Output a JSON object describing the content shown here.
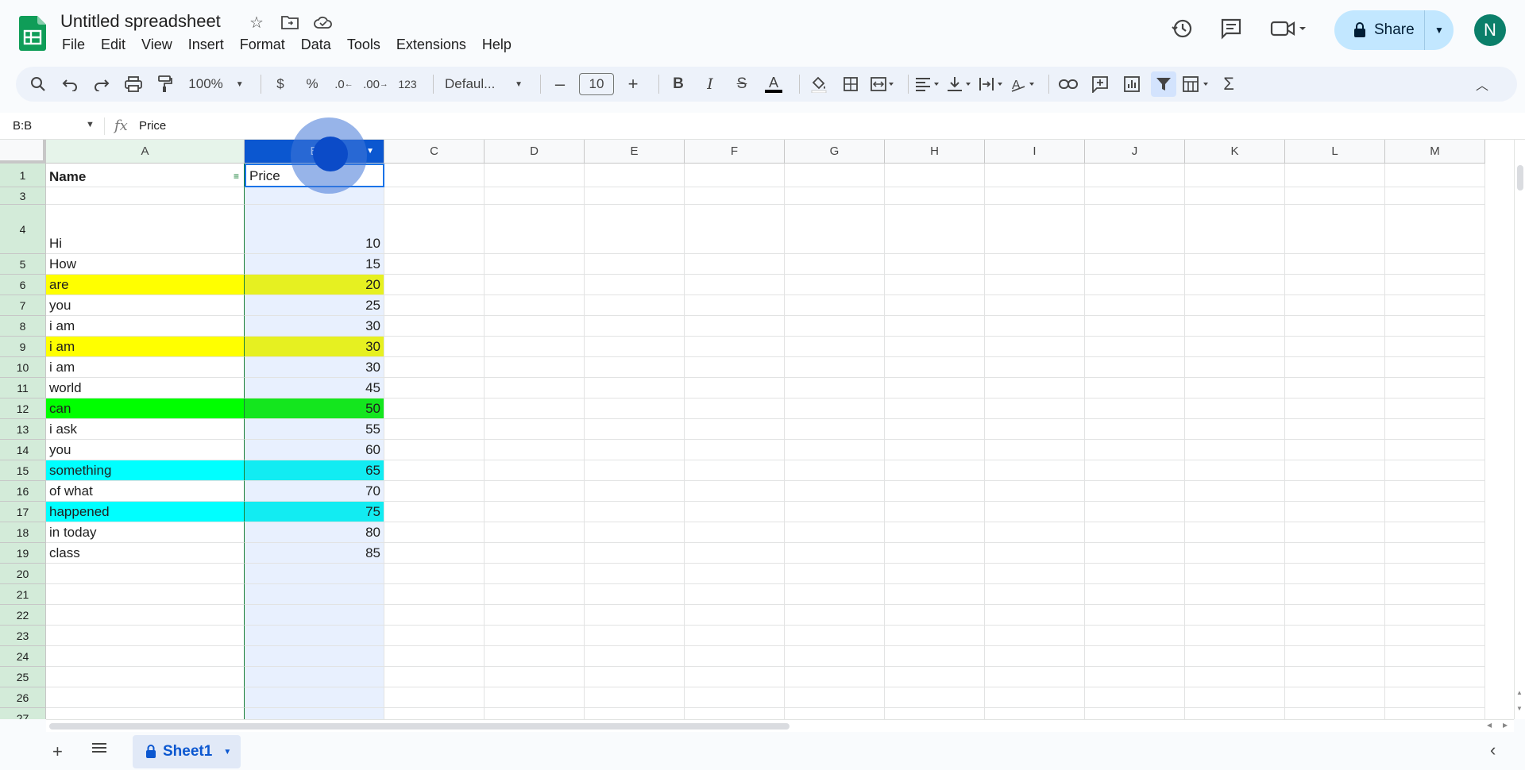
{
  "app": {
    "doc_title": "Untitled spreadsheet",
    "menu": [
      "File",
      "Edit",
      "View",
      "Insert",
      "Format",
      "Data",
      "Tools",
      "Extensions",
      "Help"
    ],
    "share_label": "Share",
    "avatar_letter": "N",
    "accent": "#0b57d0",
    "sheets_green": "#0f9d58"
  },
  "toolbar": {
    "zoom": "100%",
    "currency": "$",
    "percent": "%",
    "dec_decrease": ".0",
    "dec_increase": ".00",
    "number_format": "123",
    "font": "Defaul...",
    "font_size": "10"
  },
  "formula_bar": {
    "name_box": "B:B",
    "fx": "fx",
    "content": "Price"
  },
  "columns": [
    "A",
    "B",
    "C",
    "D",
    "E",
    "F",
    "G",
    "H",
    "I",
    "J",
    "K",
    "L",
    "M"
  ],
  "rows": [
    {
      "n": "1",
      "a": "Name",
      "b": "Price",
      "color": ""
    },
    {
      "n": "3",
      "a": "",
      "b": "",
      "color": ""
    },
    {
      "n": "4",
      "a": "Hi",
      "b": "10",
      "color": ""
    },
    {
      "n": "5",
      "a": "How",
      "b": "15",
      "color": ""
    },
    {
      "n": "6",
      "a": "are",
      "b": "20",
      "color": "#ffff00"
    },
    {
      "n": "7",
      "a": "you",
      "b": "25",
      "color": ""
    },
    {
      "n": "8",
      "a": "i am",
      "b": "30",
      "color": ""
    },
    {
      "n": "9",
      "a": "i am",
      "b": "30",
      "color": "#ffff00"
    },
    {
      "n": "10",
      "a": "i am",
      "b": "30",
      "color": ""
    },
    {
      "n": "11",
      "a": "world",
      "b": "45",
      "color": ""
    },
    {
      "n": "12",
      "a": "can",
      "b": "50",
      "color": "#00ff00"
    },
    {
      "n": "13",
      "a": "i ask",
      "b": "55",
      "color": ""
    },
    {
      "n": "14",
      "a": "you",
      "b": "60",
      "color": ""
    },
    {
      "n": "15",
      "a": "something",
      "b": "65",
      "color": "#00ffff"
    },
    {
      "n": "16",
      "a": "of what",
      "b": "70",
      "color": ""
    },
    {
      "n": "17",
      "a": "happened",
      "b": "75",
      "color": "#00ffff"
    },
    {
      "n": "18",
      "a": "in today",
      "b": "80",
      "color": ""
    },
    {
      "n": "19",
      "a": "class",
      "b": "85",
      "color": ""
    },
    {
      "n": "20",
      "a": "",
      "b": "",
      "color": ""
    },
    {
      "n": "21",
      "a": "",
      "b": "",
      "color": ""
    },
    {
      "n": "22",
      "a": "",
      "b": "",
      "color": ""
    },
    {
      "n": "23",
      "a": "",
      "b": "",
      "color": ""
    },
    {
      "n": "24",
      "a": "",
      "b": "",
      "color": ""
    },
    {
      "n": "25",
      "a": "",
      "b": "",
      "color": ""
    },
    {
      "n": "26",
      "a": "",
      "b": "",
      "color": ""
    },
    {
      "n": "27",
      "a": "",
      "b": "",
      "color": ""
    }
  ],
  "sheet_tab": "Sheet1"
}
